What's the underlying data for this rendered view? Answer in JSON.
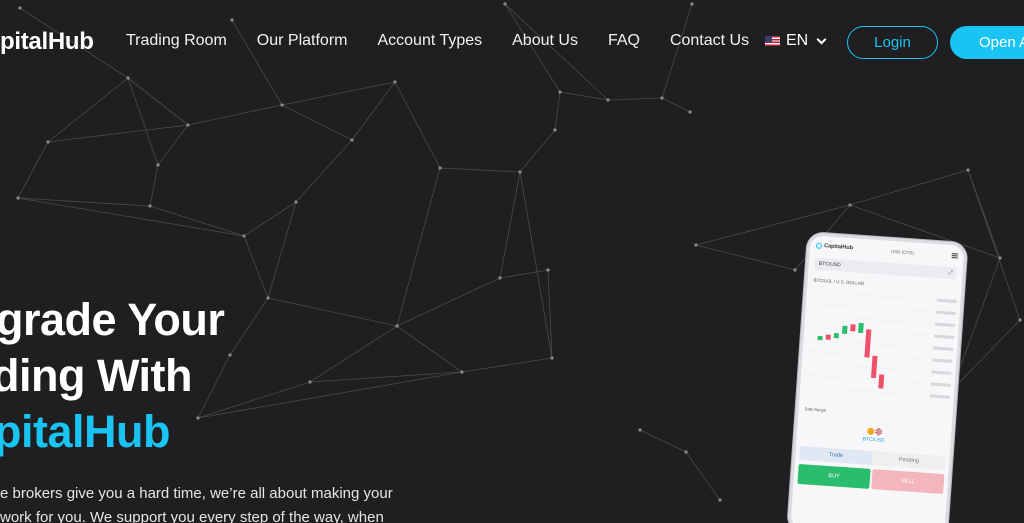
{
  "brand": {
    "logo_text": "pitalHub"
  },
  "nav": {
    "items": [
      "Trading Room",
      "Our Platform",
      "Account Types",
      "About Us",
      "FAQ",
      "Contact Us"
    ]
  },
  "lang": {
    "label": "EN",
    "flag_icon": "us-flag-icon"
  },
  "auth": {
    "login_label": "Login",
    "open_label": "Open A"
  },
  "hero": {
    "line1": "grade Your",
    "line2": "ding With",
    "line3": "pitalHub",
    "body": "e brokers give you a hard time, we’re all about making your work for you. We support you every step of the way, when"
  },
  "phone": {
    "logo_text": "CapitalHub",
    "currency": "USD (CFD)",
    "pair": "BTC/USD",
    "chart_label": "BTC/USL / U.S. DOLLAR",
    "tools_label": "Date Range",
    "coin_pair": "BTC/USD",
    "tab_trade": "Trade",
    "tab_pending": "Pending",
    "buy_label": "BUY",
    "sell_label": "SELL"
  },
  "colors": {
    "accent": "#19c3f2",
    "background": "#1f1e20",
    "buy": "#2bbd6e",
    "sell": "#f0506a"
  }
}
